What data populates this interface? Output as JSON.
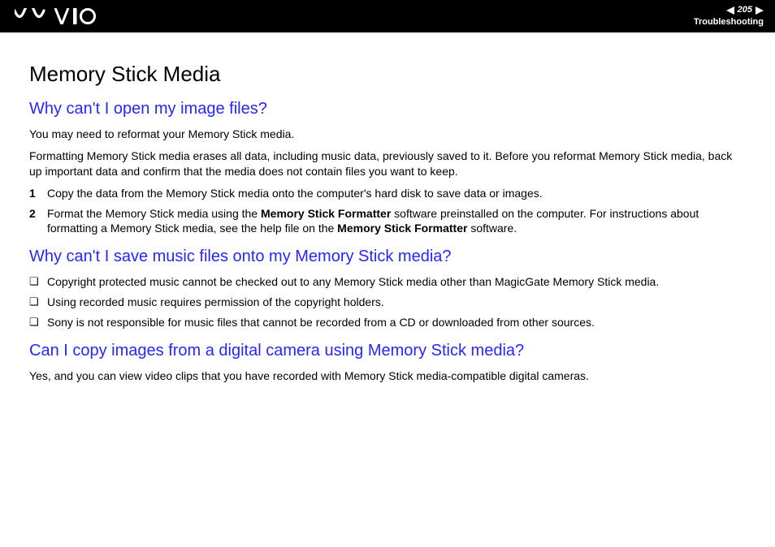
{
  "header": {
    "page_number": "205",
    "section": "Troubleshooting"
  },
  "page": {
    "title": "Memory Stick Media",
    "q1": {
      "heading": "Why can't I open my image files?",
      "p1": "You may need to reformat your Memory Stick media.",
      "p2": "Formatting Memory Stick media erases all data, including music data, previously saved to it. Before you reformat Memory Stick media, back up important data and confirm that the media does not contain files you want to keep.",
      "step1_num": "1",
      "step1": "Copy the data from the Memory Stick media onto the computer's hard disk to save data or images.",
      "step2_num": "2",
      "step2_a": "Format the Memory Stick media using the ",
      "step2_b": "Memory Stick Formatter",
      "step2_c": " software preinstalled on the computer. For instructions about formatting a Memory Stick media, see the help file on the ",
      "step2_d": "Memory Stick Formatter",
      "step2_e": " software."
    },
    "q2": {
      "heading": "Why can't I save music files onto my Memory Stick media?",
      "b1": "Copyright protected music cannot be checked out to any Memory Stick media other than MagicGate Memory Stick media.",
      "b2": "Using recorded music requires permission of the copyright holders.",
      "b3": "Sony is not responsible for music files that cannot be recorded from a CD or downloaded from other sources."
    },
    "q3": {
      "heading": "Can I copy images from a digital camera using Memory Stick media?",
      "p1": "Yes, and you can view video clips that you have recorded with Memory Stick media-compatible digital cameras."
    }
  }
}
